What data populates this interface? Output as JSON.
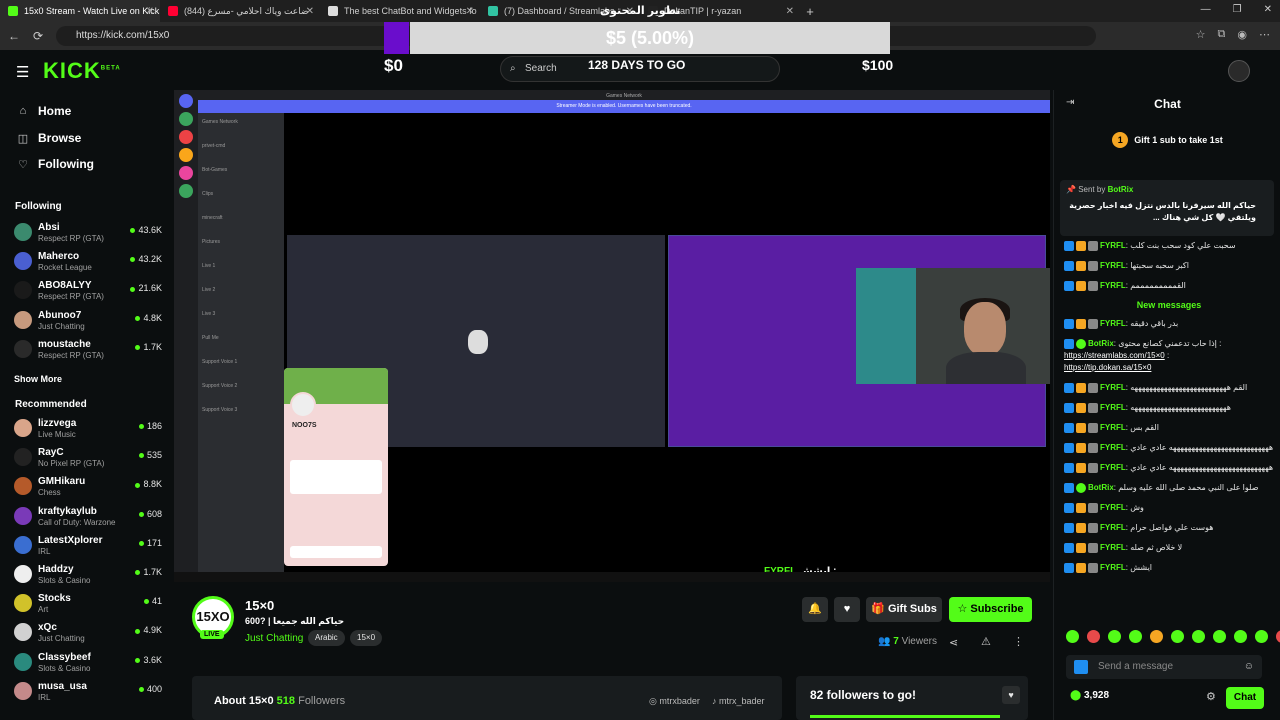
{
  "browser": {
    "tabs": [
      {
        "label": "15x0 Stream - Watch Live on Kick",
        "color": "#53fc18"
      },
      {
        "label": "(844) ضاعت وياك احلامي -مسرع",
        "color": "#ff0033"
      },
      {
        "label": "The best ChatBot and Widgets fo",
        "color": "#dddddd"
      },
      {
        "label": "(7) Dashboard / Streamlabs",
        "color": "#31c3a2"
      },
      {
        "label": "DokanTIP | r-yazan",
        "color": "#222222"
      }
    ],
    "tab_overlay_text": "تطوير المحتوى",
    "url": "https://kick.com/15x0"
  },
  "goal_overlay": {
    "progress_label": "$5 (5.00%)",
    "progress_percent": 5,
    "left_amount": "$0",
    "right_amount": "$100",
    "days_text": "128 DAYS TO GO"
  },
  "header": {
    "logo": "KICK",
    "logo_sup": "BETA",
    "search_placeholder": "Search"
  },
  "sidebar": {
    "nav": [
      {
        "label": "Home",
        "icon": "home-icon"
      },
      {
        "label": "Browse",
        "icon": "browse-icon"
      },
      {
        "label": "Following",
        "icon": "heart-icon"
      }
    ],
    "following_title": "Following",
    "following": [
      {
        "name": "Absi",
        "category": "Respect RP (GTA)",
        "viewers": "43.6K",
        "color": "#3b8a6e"
      },
      {
        "name": "Maherco",
        "category": "Rocket League",
        "viewers": "43.2K",
        "color": "#4a5fd1"
      },
      {
        "name": "ABO8ALYY",
        "category": "Respect RP (GTA)",
        "viewers": "21.6K",
        "color": "#1a1a1a"
      },
      {
        "name": "Abunoo7",
        "category": "Just Chatting",
        "viewers": "4.8K",
        "color": "#c79a7e"
      },
      {
        "name": "moustache",
        "category": "Respect RP (GTA)",
        "viewers": "1.7K",
        "color": "#2a2a2a"
      }
    ],
    "show_more": "Show More",
    "recommended_title": "Recommended",
    "recommended": [
      {
        "name": "lizzvega",
        "category": "Live Music",
        "viewers": "186",
        "color": "#d9a58a"
      },
      {
        "name": "RayC",
        "category": "No Pixel RP (GTA)",
        "viewers": "535",
        "color": "#222222"
      },
      {
        "name": "GMHikaru",
        "category": "Chess",
        "viewers": "8.8K",
        "color": "#b55a2a"
      },
      {
        "name": "kraftykaylub",
        "category": "Call of Duty: Warzone",
        "viewers": "608",
        "color": "#7a3ab8"
      },
      {
        "name": "LatestXplorer",
        "category": "IRL",
        "viewers": "171",
        "color": "#3a6ed1"
      },
      {
        "name": "Haddzy",
        "category": "Slots & Casino",
        "viewers": "1.7K",
        "color": "#eeeeee"
      },
      {
        "name": "Stocks",
        "category": "Art",
        "viewers": "41",
        "color": "#d1c22a"
      },
      {
        "name": "xQc",
        "category": "Just Chatting",
        "viewers": "4.9K",
        "color": "#d1d1d1"
      },
      {
        "name": "Classybeef",
        "category": "Slots & Casino",
        "viewers": "3.6K",
        "color": "#2a8a7e"
      },
      {
        "name": "musa_usa",
        "category": "IRL",
        "viewers": "400",
        "color": "#c48a8a"
      }
    ]
  },
  "video": {
    "discord_title": "Games Network",
    "notice": "Streamer Mode is enabled. Usernames have been truncated.",
    "channels": [
      "Games Network",
      "privet-cmd",
      "Bot-Games",
      "Clips",
      "minecraft",
      "Pictures",
      "Live 1",
      "Live 2",
      "Live 3",
      "Pull Me",
      "Support Voice 1",
      "Support Voice 2",
      "Support Voice 3"
    ],
    "profile_name": "NOO7S",
    "caption_user": "FYRFL",
    "caption_text": "ايشش :"
  },
  "stream": {
    "avatar_text": "15XO",
    "live": "LIVE",
    "name": "15×0",
    "title": "600? | حياكم الله جميعا",
    "category": "Just Chatting",
    "tags": [
      "Arabic",
      "15×0"
    ],
    "gift_subs": "Gift Subs",
    "subscribe": "Subscribe",
    "viewers_count": "7",
    "viewers_label": "Viewers"
  },
  "about": {
    "title": "About 15×0",
    "followers": "518",
    "followers_label": "Followers",
    "instagram": "mtrxbader",
    "tiktok": "mtrx_bader"
  },
  "followers_goal": {
    "text": "82 followers to go!"
  },
  "chat": {
    "title": "Chat",
    "gift_badge": "1",
    "gift_text": "Gift 1 sub to take 1st",
    "pinned_by": "Sent by",
    "pinned_user": "BotRix",
    "pinned_text": "حياكم الله سيرفرنا بالدس نتزل فيه اخبار حصرية ويلتقي 🤍 كل شي هناك ...",
    "messages_before": [
      {
        "user": "FYRFL",
        "text": "سحبت علي كود سحب بنت كلب"
      },
      {
        "user": "FYRFL",
        "text": "اكبر سحبه سحبتها"
      },
      {
        "user": "FYRFL",
        "text": "القمممممممممم"
      }
    ],
    "new_messages": "New messages",
    "messages_after": [
      {
        "user": "FYRFL",
        "text": "بدر باقي دقيقه"
      },
      {
        "user": "BotRix",
        "text": "إذا حاب تدعمني كصانع محتوى :",
        "link1": "https://streamlabs.com/15×0",
        "link2": "https://tip.dokan.sa/15×0"
      },
      {
        "user": "FYRFL",
        "text": "القم ههههههههههههههههههههههههههه"
      },
      {
        "user": "FYRFL",
        "text": "ههههههههههههههههههههههههههه"
      },
      {
        "user": "FYRFL",
        "text": "القم بس"
      },
      {
        "user": "FYRFL",
        "text": "هههههههههههههههههههههههههههه عادي عادي"
      },
      {
        "user": "FYRFL",
        "text": "هههههههههههههههههههههههههههه عادي عادي"
      },
      {
        "user": "BotRix",
        "text": "صلوا على النبي محمد صلى الله عليه وسلم"
      },
      {
        "user": "FYRFL",
        "text": "وش"
      },
      {
        "user": "FYRFL",
        "text": "هوست علي فواصل حرام"
      },
      {
        "user": "FYRFL",
        "text": "لا خلاص ثم صله"
      },
      {
        "user": "FYRFL",
        "text": "ايشش"
      }
    ],
    "send_placeholder": "Send a message",
    "points": "3,928",
    "chat_button": "Chat"
  }
}
